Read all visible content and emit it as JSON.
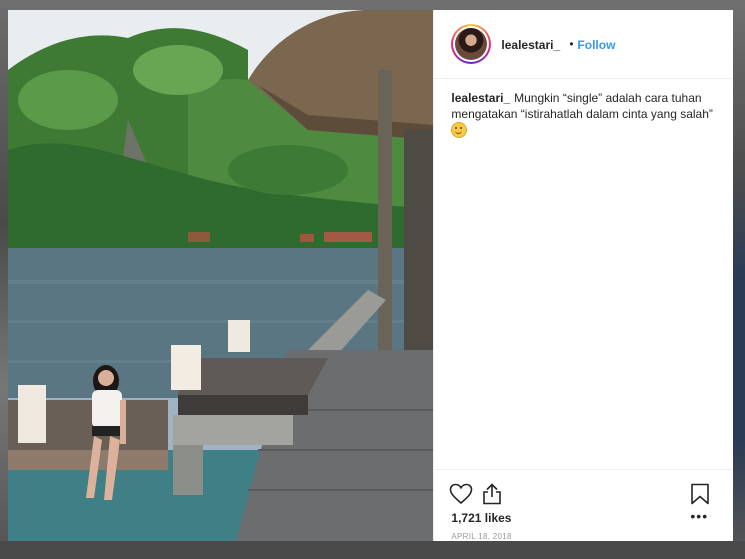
{
  "post": {
    "username": "lealestari_",
    "separator": "•",
    "follow_label": "Follow",
    "caption_user": "lealestari_",
    "caption_text": "Mungkin “single” adalah cara tuhan mengatakan “istirahatlah dalam cinta yang salah”",
    "caption_emoji": "smiling-face",
    "likes": "1,721 likes",
    "date": "APRIL 18, 2018",
    "more_label": "•••"
  },
  "icons": {
    "like": "heart-icon",
    "share": "share-icon",
    "save": "bookmark-icon",
    "more": "more-options-icon"
  },
  "colors": {
    "link": "#3897f0",
    "text": "#262626",
    "muted": "#999999"
  }
}
